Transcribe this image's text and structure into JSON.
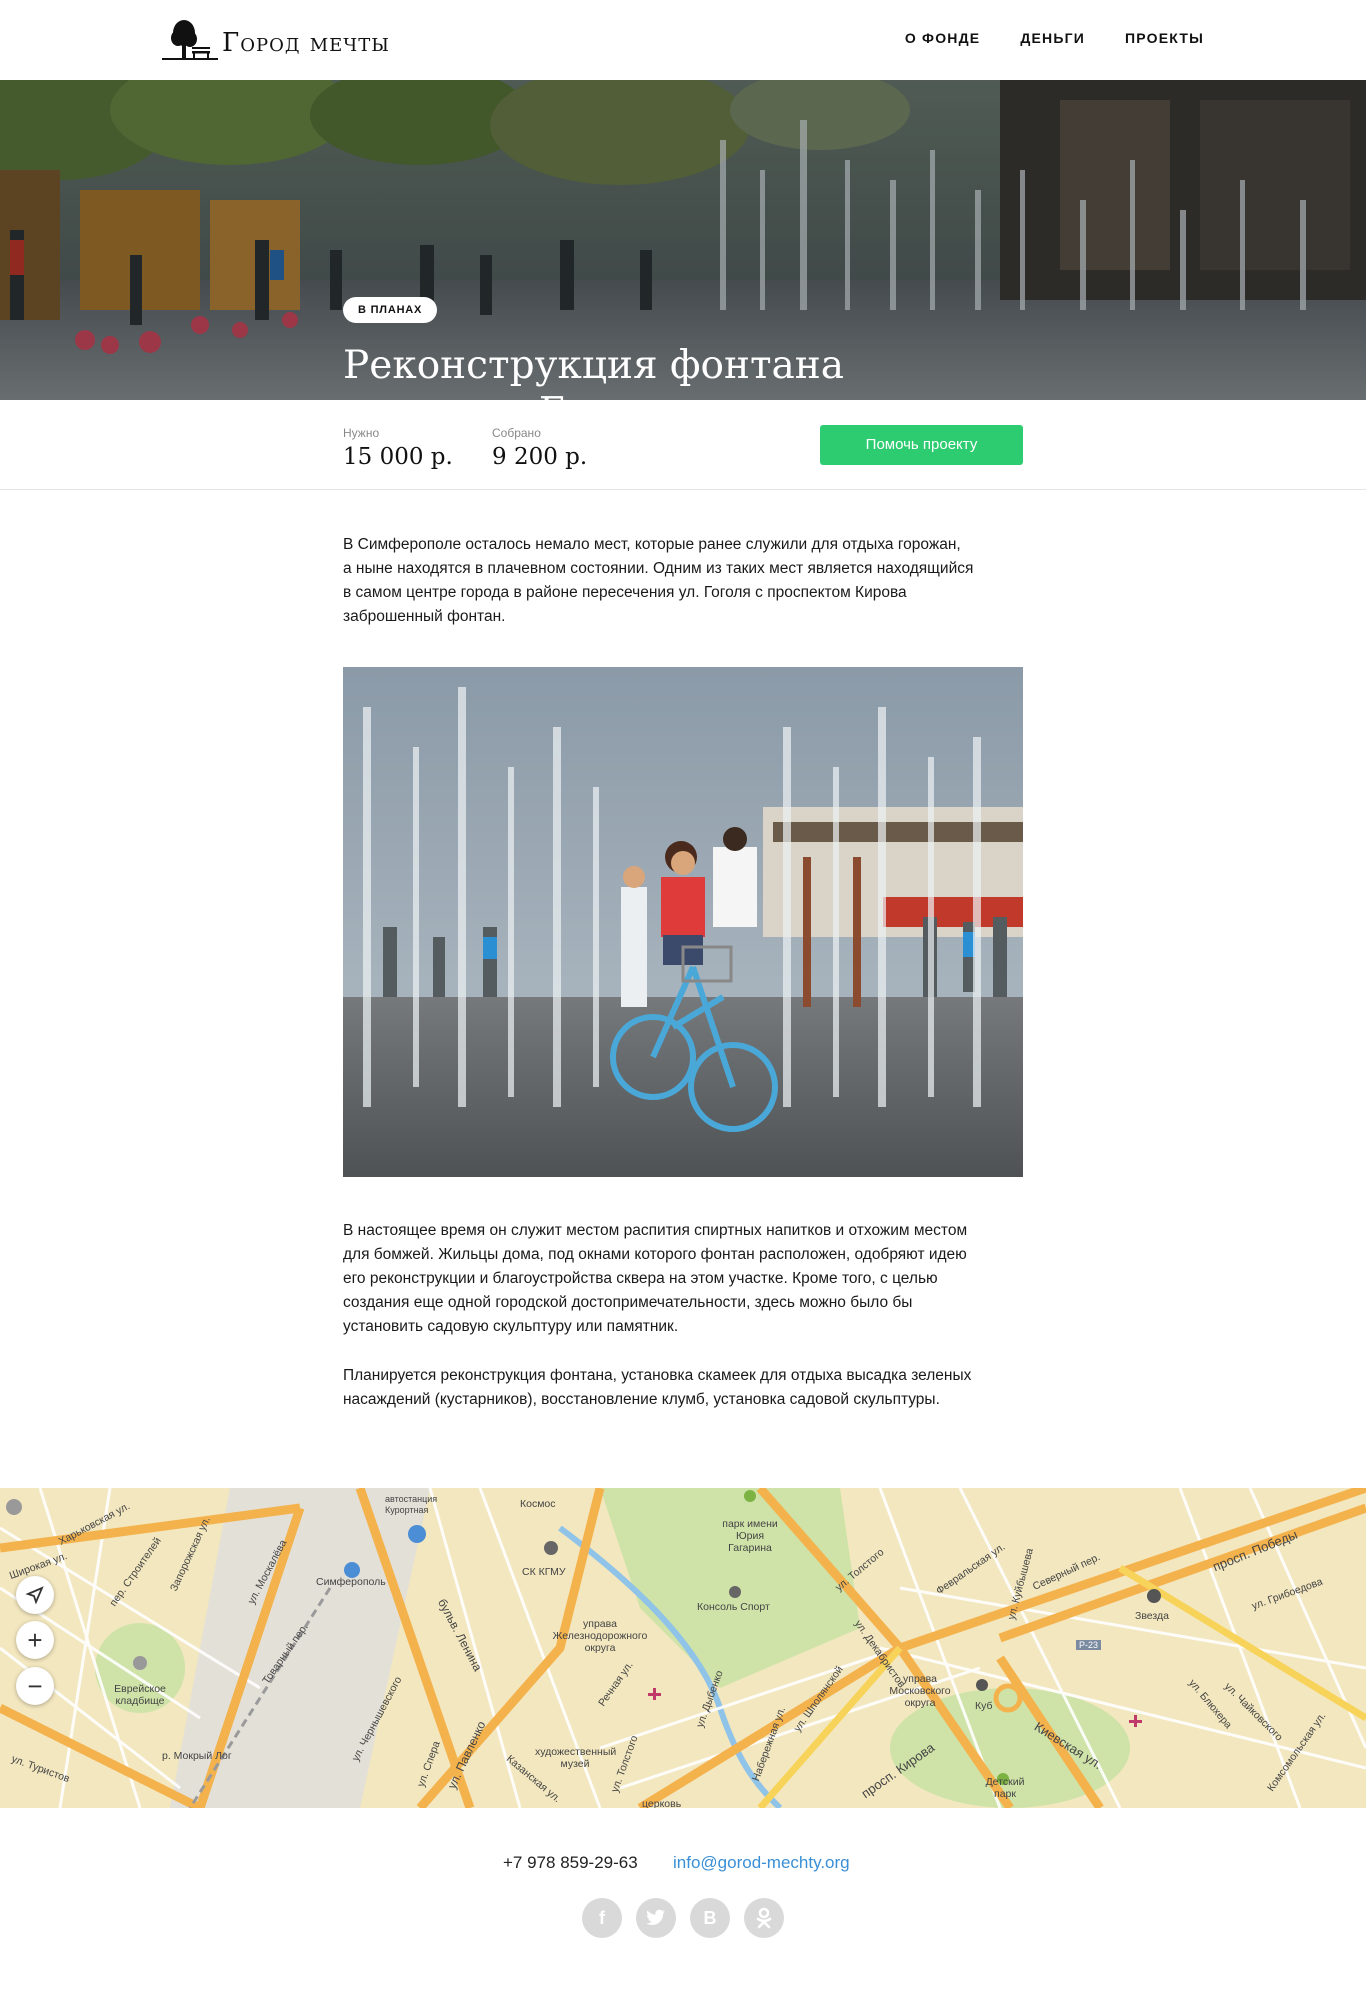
{
  "header": {
    "logo_text": "Город мечты",
    "nav": [
      "О фонде",
      "Деньги",
      "Проекты"
    ]
  },
  "hero": {
    "badge": "В планах",
    "title_line1": "Реконструкция фонтана",
    "title_line2": "на улице Гоголя"
  },
  "stats": {
    "need_label": "Нужно",
    "need_value": "15 000 р.",
    "raised_label": "Собрано",
    "raised_value": "9 200 р.",
    "help_button": "Помочь проекту"
  },
  "article": {
    "p1_lines": [
      "В Симферополе осталось немало мест, которые ранее служили для отдыха горожан,",
      "а ныне находятся в плачевном состоянии. Одним из таких мест является находящийся",
      "в самом центре города в районе пересечения ул. Гоголя с проспектом Кирова",
      "заброшенный фонтан."
    ],
    "p2_lines": [
      "В настоящее время он служит местом распития спиртных напитков и отхожим местом",
      "для бомжей. Жильцы дома, под окнами которого фонтан расположен, одобряют идею",
      "его реконструкции и благоустройства сквера на этом участке. Кроме того, с целью",
      "создания еще одной городской достопримечательности, здесь можно было бы",
      "установить садовую скульптуру или памятник."
    ],
    "p3_lines": [
      "Планируется реконструкция фонтана, установка скамеек для отдыха высадка зеленых",
      "насаждений (кустарников), восстановление клумб, установка садовой скульптуры."
    ]
  },
  "map": {
    "labels": [
      "Харьковская ул.",
      "Широкая ул.",
      "пер. Строителей",
      "Запорожская ул.",
      "автостанция Курортная",
      "Симферополь",
      "ул. Москалёва",
      "Космос",
      "СК КГМУ",
      "парк имени Юрия Гагарина",
      "Консоль Спорт",
      "ул. Толстого",
      "Февральская ул.",
      "ул. Куйбышева",
      "Северный пер.",
      "просп. Победы",
      "Звезда",
      "ул. Грибоедова",
      "управа Железнодорожного округа",
      "Речная ул.",
      "бульв. Ленина",
      "Еврейское кладбище",
      "ул. Декабристов",
      "ул. Шполянской",
      "управа Московского округа",
      "Куб",
      "Киевская ул.",
      "Детский парк",
      "художественный музей",
      "просп. Кирова",
      "ул. Павленко",
      "ул. Чернышевского",
      "Казанская ул.",
      "р. Мокрый Лог",
      "ул. Туристов",
      "ул. Блюхера",
      "ул. Чайковского",
      "Комсомольская ул.",
      "ул. Дыбенко",
      "Набережная ул.",
      "Товарный пер.",
      "ул. Спера",
      "ул. Толстого",
      "церковь",
      "P-23"
    ],
    "controls": [
      "locate-icon",
      "zoom-in-icon",
      "zoom-out-icon"
    ]
  },
  "footer": {
    "phone": "+7 978 859-29-63",
    "email": "info@gorod-mechty.org",
    "socials": [
      "f",
      "t",
      "B",
      "ok"
    ]
  },
  "colors": {
    "accent_green": "#2ecc71",
    "link_blue": "#3a8fd6",
    "map_bg": "#f3e7bf",
    "map_road": "#f4b24d",
    "map_park": "#cfe3a8",
    "map_water": "#8fc3e8"
  }
}
